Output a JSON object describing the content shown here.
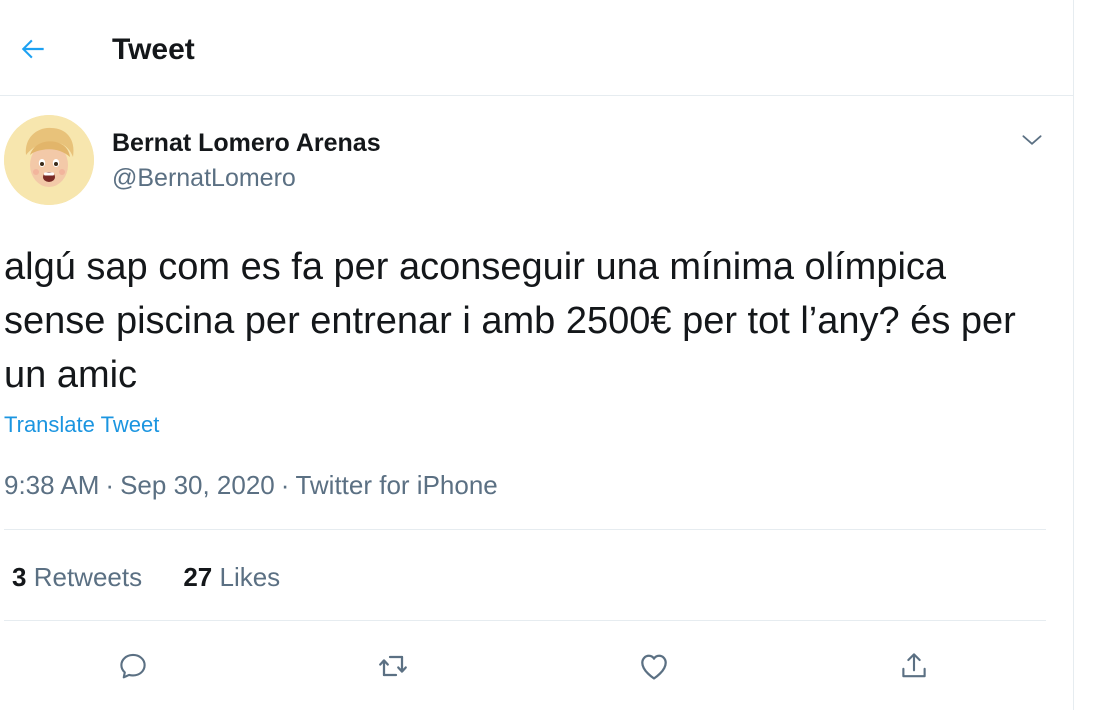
{
  "header": {
    "title": "Tweet",
    "back_icon": "arrow-left-icon"
  },
  "author": {
    "display_name": "Bernat Lomero Arenas",
    "handle": "@BernatLomero",
    "avatar_icon": "memoji-avatar"
  },
  "tweet": {
    "text": "algú sap com es fa per aconseguir una mínima olímpica sense piscina per entrenar i amb 2500€ per tot l’any? és per un amic",
    "translate_label": "Translate Tweet",
    "time": "9:38 AM",
    "separator": "·",
    "date": "Sep 30, 2020",
    "source": "Twitter for iPhone"
  },
  "stats": {
    "retweets_count": "3",
    "retweets_label": "Retweets",
    "likes_count": "27",
    "likes_label": "Likes"
  },
  "actions": {
    "reply_icon": "reply-icon",
    "retweet_icon": "retweet-icon",
    "like_icon": "heart-icon",
    "share_icon": "share-icon"
  },
  "colors": {
    "accent": "#1da1f2",
    "link": "#1b95e0",
    "secondary_text": "#5b7083",
    "divider": "#e6ecf0"
  }
}
